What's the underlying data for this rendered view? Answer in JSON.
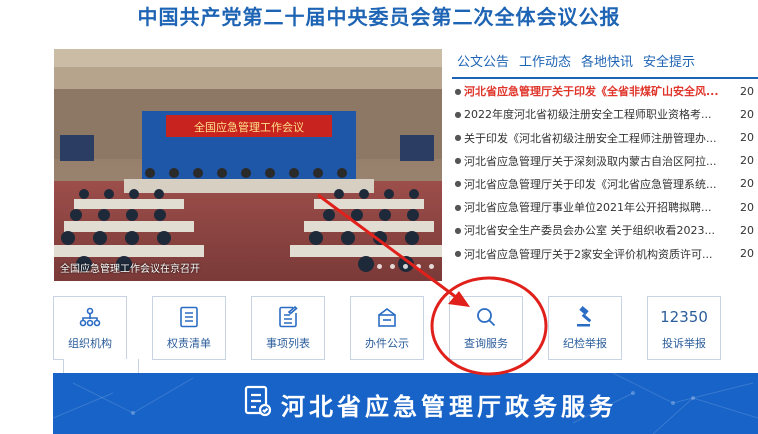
{
  "header": {
    "title": "中国共产党第二十届中央委员会第二次全体会议公报"
  },
  "slider": {
    "banner_text": "全国应急管理工作会议",
    "caption": "全国应急管理工作会议在京召开"
  },
  "news": {
    "tabs": [
      {
        "label": "公文公告"
      },
      {
        "label": "工作动态"
      },
      {
        "label": "各地快讯"
      },
      {
        "label": "安全提示"
      }
    ],
    "items": [
      {
        "title": "河北省应急管理厅关于印发《全省非煤矿山安全风...",
        "date": "20"
      },
      {
        "title": "2022年度河北省初级注册安全工程师职业资格考...",
        "date": "20"
      },
      {
        "title": "关于印发《河北省初级注册安全工程师注册管理办...",
        "date": "20"
      },
      {
        "title": "河北省应急管理厅关于深刻汲取内蒙古自治区阿拉...",
        "date": "20"
      },
      {
        "title": "河北省应急管理厅关于印发《河北省应急管理系统...",
        "date": "20"
      },
      {
        "title": "河北省应急管理厅事业单位2021年公开招聘拟聘...",
        "date": "20"
      },
      {
        "title": "河北省安全生产委员会办公室 关于组织收看2023...",
        "date": "20"
      },
      {
        "title": "河北省应急管理厅关于2家安全评价机构资质许可...",
        "date": "20"
      }
    ]
  },
  "services": {
    "items": [
      {
        "label": "组织机构",
        "icon": "org-chart-icon"
      },
      {
        "label": "权责清单",
        "icon": "list-document-icon"
      },
      {
        "label": "事项列表",
        "icon": "edit-document-icon"
      },
      {
        "label": "办件公示",
        "icon": "notice-board-icon"
      },
      {
        "label": "查询服务",
        "icon": "search-icon"
      },
      {
        "label": "纪检举报",
        "icon": "gavel-icon"
      },
      {
        "label": "投诉举报",
        "number": "12350",
        "icon": "hotline-number"
      }
    ]
  },
  "banner": {
    "title": "河北省应急管理厅政务服务",
    "icon": "service-document-icon"
  },
  "colors": {
    "primary_blue": "#1e64b4",
    "banner_blue": "#1763c8",
    "highlight_red": "#e0352b"
  }
}
